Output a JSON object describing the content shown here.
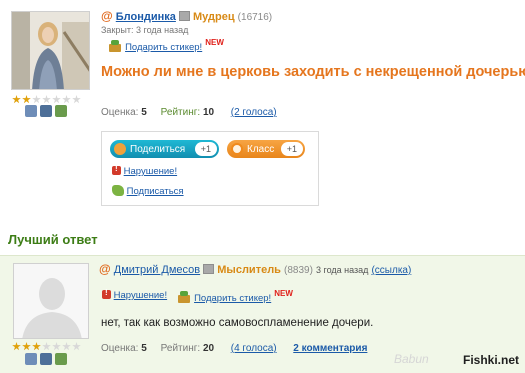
{
  "question": {
    "user": {
      "name": "Блондинка",
      "rank": "Мудрец",
      "score": "(16716)",
      "rating_stars": 2
    },
    "closed": "Закрыт: 3 года назад",
    "gift_label": "Подарить стикер!",
    "new_label": "NEW",
    "title": "Можно ли мне в церковь заходить с некрещенной дочерью?",
    "stats": {
      "score_label": "Оценка:",
      "score_value": "5",
      "rating_label": "Рейтинг:",
      "rating_value": "10",
      "votes": "(2 голоса)"
    }
  },
  "share": {
    "share_label": "Поделиться",
    "share_count": "+1",
    "class_label": "Класс",
    "class_count": "+1",
    "report_label": "Нарушение!",
    "subscribe_label": "Подписаться"
  },
  "best_answer": {
    "heading": "Лучший ответ",
    "user": {
      "name": "Дмитрий Дмесов",
      "rank": "Мыслитель",
      "score": "(8839)",
      "rating_stars": 3
    },
    "time": "3 года назад",
    "link_label": "(ссылка)",
    "report_label": "Нарушение!",
    "gift_label": "Подарить стикер!",
    "new_label": "NEW",
    "text": "нет, так как возможно самовоспламенение дочери.",
    "stats": {
      "score_label": "Оценка:",
      "score_value": "5",
      "rating_label": "Рейтинг:",
      "rating_value": "20",
      "votes": "(4 голоса)",
      "comments": "2 комментария"
    }
  },
  "watermark": {
    "site": "Fishki.net",
    "faint": "Babun"
  },
  "colors": {
    "accent_orange": "#e5761e",
    "link_blue": "#1b5aa8",
    "green_heading": "#3d7d16",
    "answer_bg": "#f1f7e8"
  }
}
